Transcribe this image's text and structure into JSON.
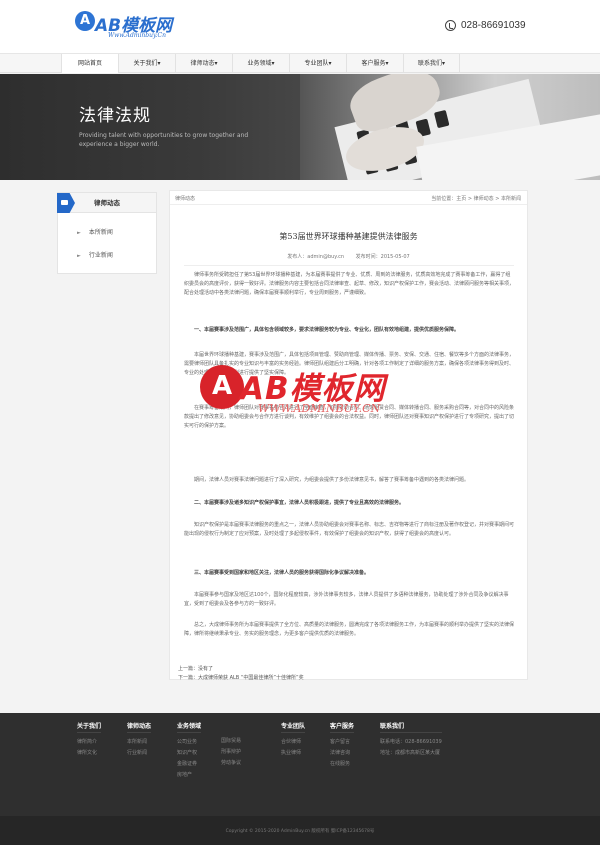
{
  "header": {
    "logo_text": "AB模板网",
    "logo_sub": "Www.Adminbuy.Cn",
    "phone": "028-86691039"
  },
  "nav": {
    "items": [
      {
        "label": "网站首页"
      },
      {
        "label": "关于我们▾"
      },
      {
        "label": "律师动态▾"
      },
      {
        "label": "业务领域▾"
      },
      {
        "label": "专业团队▾"
      },
      {
        "label": "客户服务▾"
      },
      {
        "label": "联系我们▾"
      }
    ]
  },
  "banner": {
    "title": "法律法规",
    "subtitle": "Providing talent with opportunities to grow together and experience a bigger world."
  },
  "sidebar": {
    "title": "律师动态",
    "items": [
      {
        "label": "本所新闻"
      },
      {
        "label": "行业新闻"
      }
    ]
  },
  "main": {
    "section_label": "律师动态",
    "breadcrumb": "当前位置：主页 > 律师动态 > 本所新闻",
    "title": "第53届世界环球播种基建提供法律服务",
    "author": "发布人：admin@buy.cn",
    "date": "发布时间：2015-05-07",
    "paragraphs": [
      {
        "text": "律师事务所受聘担任了第53届世界环球播种基建，为本届赛事提供了专业、优质、周到的法律服务，优质高效地完成了赛事筹备工作，赢得了组织委员会的高度评价，获得一致好评。法律服务内容主要包括合同法律审查、起草、修改，知识产权保护工作，赛会活动、法律顾问服务等相关事项，配合处理活动中各类法律问题，确保本届赛事顺利举行，专业周到服务，严谨细致。",
        "h": false
      },
      {
        "text": "一、本届赛事涉及范围广，具体包含领域较多，要求法律服务较为专业、专业化，团队有效地组建，提供优质服务保障。",
        "h": true
      },
      {
        "text": "本届世界环球播种基建，赛事涉及范围广，具体包括项目管理、赞助商管理、媒体传播、票务、安保、交通、住宿、餐饮等多个方面的法律事务，需要律师团队具备扎实的专业知识与丰富的实务经验。律师团队组建后分工明确，针对各项工作制定了详细的服务方案，确保各项法律事务得到及时、专业的处理，为赛事顺利进行提供了坚实保障。",
        "h": false
      },
      {
        "text": "在赛事筹备期间，律师团队对赛事各类合同进行了全面审查，包括赞助合同、场馆租赁合同、媒体转播合同、服务采购合同等，对合同中的风险条款提出了修改意见，协助组委会与合作方进行谈判，有效维护了组委会的合法权益。同时，律师团队还对赛事知识产权保护进行了专项研究，提出了切实可行的保护方案。",
        "h": false
      },
      {
        "text": "期间，法律人员对赛事法律问题进行了深入研究，为组委会提供了多份法律意见书，解答了赛事筹备中遇到的各类法律问题。",
        "h": false
      },
      {
        "text": "二、本届赛事涉及诸多知识产权保护事宜，法律人员积极跟进，提供了专业且高效的法律服务。",
        "h": true
      },
      {
        "text": "知识产权保护是本届赛事法律服务的重点之一，法律人员协助组委会对赛事名称、标志、吉祥物等进行了商标注册及著作权登记，并对赛事期间可能出现的侵权行为制定了应对预案，及时处理了多起侵权事件，有效保护了组委会的知识产权，获得了组委会的高度认可。",
        "h": false
      },
      {
        "text": "三、本届赛事受到国家和地区关注，法律人员的服务获得国际化争议解决准备。",
        "h": true
      },
      {
        "text": "本届赛事参与国家及地区达100个，国际化程度较高，涉外法律事务较多，法律人员提供了多语种法律服务，协助处理了涉外合同及争议解决事宜，受到了组委会及各参与方的一致好评。",
        "h": false
      },
      {
        "text": "总之，大成律师事务所为本届赛事提供了全方位、高质量的法律服务，圆满完成了各项法律服务工作，为本届赛事的顺利举办提供了坚实的法律保障，律所将继续秉承专业、务实的服务理念，为更多客户提供优质的法律服务。",
        "h": false
      }
    ],
    "prev": "上一篇：没有了",
    "next": "下一篇：大成律师荣获 ALB “中国最佳律所”十佳律所”奖"
  },
  "watermark": {
    "text": "AB模板网",
    "sub": "WWW.ADMINBUY.CN"
  },
  "footer": {
    "columns": [
      {
        "title": "关于我们",
        "items": [
          "律所简介",
          "律所文化"
        ]
      },
      {
        "title": "律师动态",
        "items": [
          "本所新闻",
          "行业新闻"
        ]
      },
      {
        "title": "业务领域",
        "items": [
          "公司业务",
          "知识产权",
          "金融证券",
          "房地产"
        ],
        "sub": [
          "国际贸易",
          "刑事辩护",
          "劳动争议"
        ]
      },
      {
        "title": "专业团队",
        "items": [
          "合伙律师",
          "执业律师"
        ]
      },
      {
        "title": "客户服务",
        "items": [
          "客户留言",
          "法律咨询",
          "在线服务"
        ]
      },
      {
        "title": "联系我们",
        "items": [
          "联系电话：028-86691039",
          "地址：成都市高新区某大厦"
        ]
      }
    ],
    "copyright": "Copyright © 2015-2020 AdminBuy.cn 版权所有 蜀ICP备12345678号"
  }
}
